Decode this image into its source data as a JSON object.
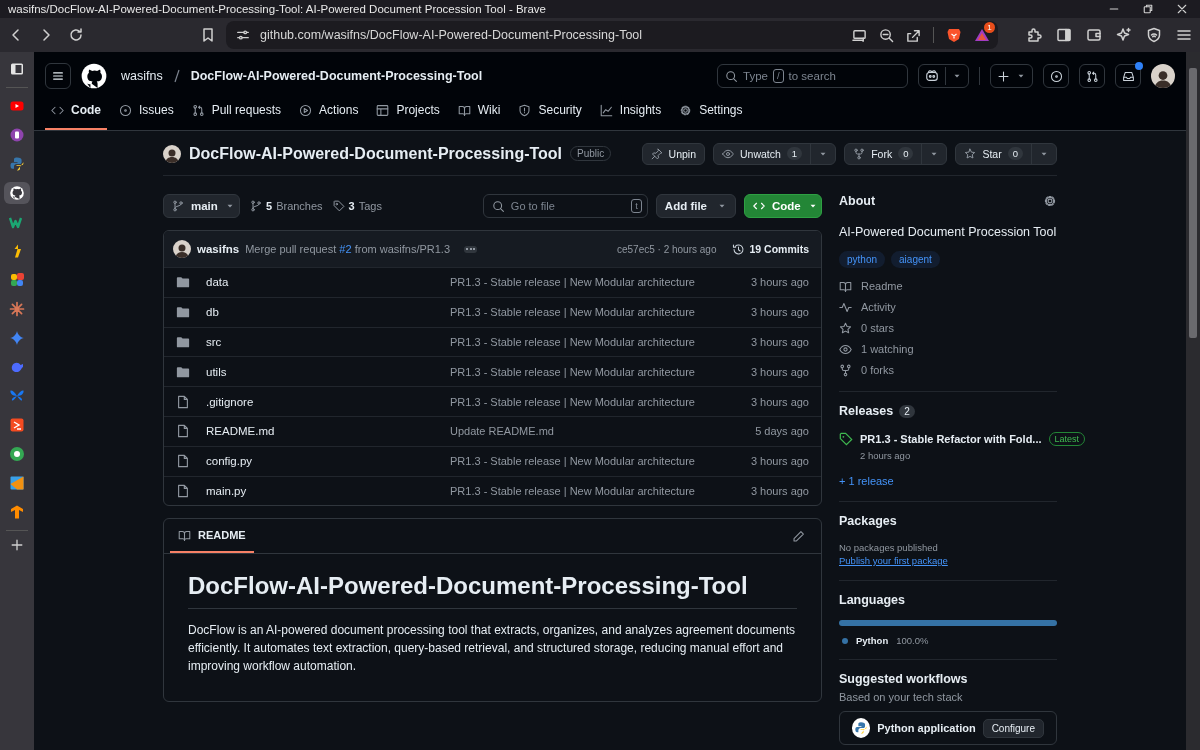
{
  "window": {
    "title": "wasifns/DocFlow-AI-Powered-Document-Processing-Tool: AI-Powered Document Procession Tool - Brave"
  },
  "browser": {
    "address": "github.com/wasifns/DocFlow-AI-Powered-Document-Processing-Tool",
    "badge": "1"
  },
  "browser_sidebar": {
    "items": [
      {
        "color": "#e5e5e5",
        "selected": false
      },
      {
        "color": "#ff0000",
        "selected": false
      },
      {
        "color": "#8e44ad",
        "selected": false
      },
      {
        "color": "#3776ab",
        "selected": false
      },
      {
        "color": "#ffffff",
        "selected": true
      },
      {
        "color": "#1ba672",
        "selected": false
      },
      {
        "color": "#fbbc04",
        "selected": false
      },
      {
        "color": "#ea4335",
        "selected": false
      },
      {
        "color": "#d97757",
        "selected": false
      },
      {
        "color": "#4285f4",
        "selected": false
      },
      {
        "color": "#4d6bfe",
        "selected": false
      },
      {
        "color": "#1877f2",
        "selected": false
      },
      {
        "color": "#f44b21",
        "selected": false
      },
      {
        "color": "#34a853",
        "selected": false
      },
      {
        "color": "#f29111",
        "selected": false
      },
      {
        "color": "#ff8c00",
        "selected": false
      }
    ]
  },
  "header": {
    "owner": "wasifns",
    "repo": "DocFlow-AI-Powered-Document-Processing-Tool",
    "search": {
      "text_1": "Type",
      "key": "/",
      "text_2": "to search"
    }
  },
  "repo_tabs": [
    {
      "label": "Code",
      "selected": true
    },
    {
      "label": "Issues",
      "selected": false
    },
    {
      "label": "Pull requests",
      "selected": false
    },
    {
      "label": "Actions",
      "selected": false
    },
    {
      "label": "Projects",
      "selected": false
    },
    {
      "label": "Wiki",
      "selected": false
    },
    {
      "label": "Security",
      "selected": false
    },
    {
      "label": "Insights",
      "selected": false
    },
    {
      "label": "Settings",
      "selected": false
    }
  ],
  "repo": {
    "title": "DocFlow-AI-Powered-Document-Processing-Tool",
    "visibility": "Public",
    "actions": [
      {
        "label": "Unpin"
      },
      {
        "label": "Unwatch",
        "count": "1"
      },
      {
        "label": "Fork",
        "count": "0"
      },
      {
        "label": "Star",
        "count": "0"
      }
    ]
  },
  "branch_bar": {
    "branch": "main",
    "branches_count": "5",
    "branches_label": "Branches",
    "tags_count": "3",
    "tags_label": "Tags",
    "file_search": {
      "placeholder": "Go to file",
      "key": "t"
    },
    "add_file": "Add file",
    "code": "Code"
  },
  "commit": {
    "author": "wasifns",
    "message_1": "Merge pull request",
    "link": "#2",
    "message_2": "from wasifns/PR1.3",
    "meta": "ce57ec5 · 2 hours ago",
    "commits_count": "19",
    "commits_label": "Commits"
  },
  "files": [
    {
      "kind": "folder",
      "name": "data",
      "message": "PR1.3 - Stable release | New Modular architecture",
      "time": "3 hours ago"
    },
    {
      "kind": "folder",
      "name": "db",
      "message": "PR1.3 - Stable release | New Modular architecture",
      "time": "3 hours ago"
    },
    {
      "kind": "folder",
      "name": "src",
      "message": "PR1.3 - Stable release | New Modular architecture",
      "time": "3 hours ago"
    },
    {
      "kind": "folder",
      "name": "utils",
      "message": "PR1.3 - Stable release | New Modular architecture",
      "time": "3 hours ago"
    },
    {
      "kind": "file",
      "name": ".gitignore",
      "message": "PR1.3 - Stable release | New Modular architecture",
      "time": "3 hours ago"
    },
    {
      "kind": "file",
      "name": "README.md",
      "message": "Update README.md",
      "time": "5 days ago"
    },
    {
      "kind": "file",
      "name": "config.py",
      "message": "PR1.3 - Stable release | New Modular architecture",
      "time": "3 hours ago"
    },
    {
      "kind": "file",
      "name": "main.py",
      "message": "PR1.3 - Stable release | New Modular architecture",
      "time": "3 hours ago"
    }
  ],
  "readme": {
    "tab": "README",
    "heading": "DocFlow-AI-Powered-Document-Processing-Tool",
    "text": "DocFlow is an AI-powered document processing tool that extracts, organizes, and analyzes agreement documents efficiently. It automates text extraction, query-based retrieval, and structured storage, reducing manual effort and improving workflow automation."
  },
  "about": {
    "title": "About",
    "description": "AI-Powered Document Procession Tool",
    "topics": [
      "python",
      "aiagent"
    ],
    "stats": [
      "Readme",
      "Activity",
      "0 stars",
      "1 watching",
      "0 forks"
    ]
  },
  "releases": {
    "title": "Releases",
    "count": "2",
    "latest": {
      "name": "PR1.3 - Stable Refactor with Fold...",
      "badge": "Latest",
      "time": "2 hours ago"
    },
    "more": "+ 1 release"
  },
  "packages": {
    "title": "Packages",
    "note": "No packages published",
    "link": "Publish your first package"
  },
  "languages": {
    "title": "Languages",
    "items": [
      {
        "name": "Python",
        "percent": "100.0%",
        "color": "#3572a5",
        "level": 1
      }
    ]
  },
  "workflows": {
    "title": "Suggested workflows",
    "subtitle": "Based on your tech stack",
    "card": {
      "name": "Python application",
      "button": "Configure"
    }
  }
}
